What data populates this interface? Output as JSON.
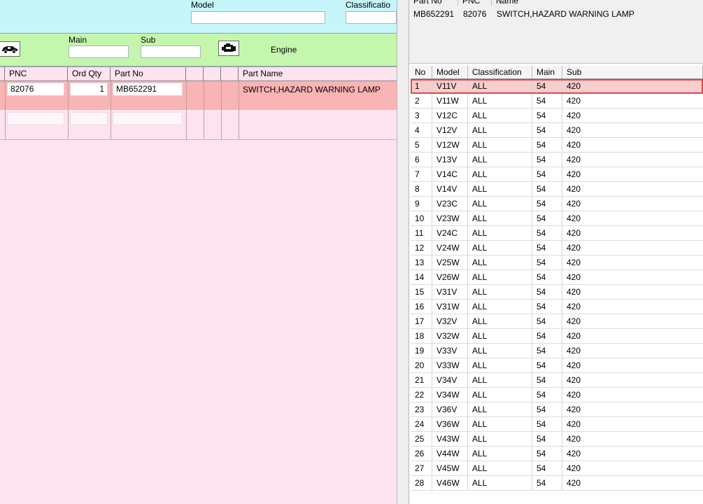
{
  "top": {
    "model_label": "Model",
    "classification_label": "Classificatio",
    "model_value": "",
    "classification_value": ""
  },
  "group": {
    "main_label": "Main",
    "sub_label": "Sub",
    "main_value": "",
    "sub_value": "",
    "engine_label": "Engine",
    "car_icon": "car-icon",
    "engine_icon": "engine-icon"
  },
  "parts_table": {
    "headers": [
      "PNC",
      "Ord Qty",
      "Part No",
      "",
      "",
      "",
      "Part Name"
    ],
    "rows": [
      {
        "pnc": "82076",
        "qty": "1",
        "part_no": "MB652291",
        "part_name": "SWITCH,HAZARD WARNING LAMP"
      },
      {
        "pnc": "",
        "qty": "",
        "part_no": "",
        "part_name": ""
      }
    ]
  },
  "detail": {
    "headers": [
      "Part No",
      "PNC",
      "Name"
    ],
    "part_no": "MB652291",
    "pnc": "82076",
    "name": "SWITCH,HAZARD WARNING LAMP"
  },
  "applicability": {
    "headers": [
      "No",
      "Model",
      "Classification",
      "Main",
      "Sub"
    ],
    "selected_index": 0,
    "rows": [
      [
        "1",
        "V11V",
        "ALL",
        "54",
        "420"
      ],
      [
        "2",
        "V11W",
        "ALL",
        "54",
        "420"
      ],
      [
        "3",
        "V12C",
        "ALL",
        "54",
        "420"
      ],
      [
        "4",
        "V12V",
        "ALL",
        "54",
        "420"
      ],
      [
        "5",
        "V12W",
        "ALL",
        "54",
        "420"
      ],
      [
        "6",
        "V13V",
        "ALL",
        "54",
        "420"
      ],
      [
        "7",
        "V14C",
        "ALL",
        "54",
        "420"
      ],
      [
        "8",
        "V14V",
        "ALL",
        "54",
        "420"
      ],
      [
        "9",
        "V23C",
        "ALL",
        "54",
        "420"
      ],
      [
        "10",
        "V23W",
        "ALL",
        "54",
        "420"
      ],
      [
        "11",
        "V24C",
        "ALL",
        "54",
        "420"
      ],
      [
        "12",
        "V24W",
        "ALL",
        "54",
        "420"
      ],
      [
        "13",
        "V25W",
        "ALL",
        "54",
        "420"
      ],
      [
        "14",
        "V26W",
        "ALL",
        "54",
        "420"
      ],
      [
        "15",
        "V31V",
        "ALL",
        "54",
        "420"
      ],
      [
        "16",
        "V31W",
        "ALL",
        "54",
        "420"
      ],
      [
        "17",
        "V32V",
        "ALL",
        "54",
        "420"
      ],
      [
        "18",
        "V32W",
        "ALL",
        "54",
        "420"
      ],
      [
        "19",
        "V33V",
        "ALL",
        "54",
        "420"
      ],
      [
        "20",
        "V33W",
        "ALL",
        "54",
        "420"
      ],
      [
        "21",
        "V34V",
        "ALL",
        "54",
        "420"
      ],
      [
        "22",
        "V34W",
        "ALL",
        "54",
        "420"
      ],
      [
        "23",
        "V36V",
        "ALL",
        "54",
        "420"
      ],
      [
        "24",
        "V36W",
        "ALL",
        "54",
        "420"
      ],
      [
        "25",
        "V43W",
        "ALL",
        "54",
        "420"
      ],
      [
        "26",
        "V44W",
        "ALL",
        "54",
        "420"
      ],
      [
        "27",
        "V45W",
        "ALL",
        "54",
        "420"
      ],
      [
        "28",
        "V46W",
        "ALL",
        "54",
        "420"
      ]
    ]
  },
  "colors": {
    "top_bar": "#c6f6fa",
    "group_bar": "#c4f7ad",
    "list_background": "#fde3f0",
    "selected_row": "#f9b4b4",
    "selection_border": "#e0454d"
  }
}
